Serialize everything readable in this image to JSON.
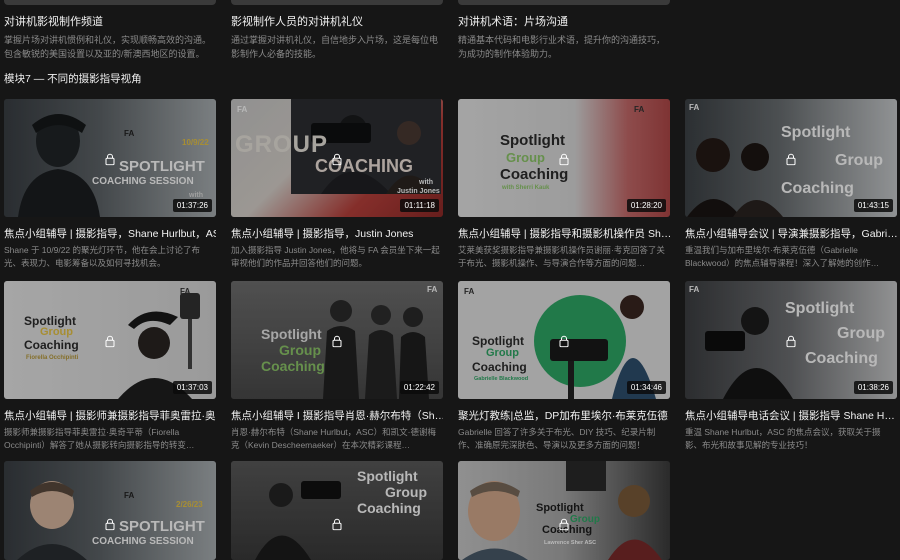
{
  "top_row": [
    {
      "title": "对讲机影视制作频道",
      "desc": "掌握片场对讲机惯例和礼仪，实现顺畅高效的沟通。包含敏锐的美国设置以及亚的/新澳西地区的设置。"
    },
    {
      "title": "影视制作人员的对讲机礼仪",
      "desc": "通过掌握对讲机礼仪，自信地步入片场，这是每位电影制作人必备的技能。"
    },
    {
      "title": "对讲机术语：片场沟通",
      "desc": "精通基本代码和电影行业术语，提升你的沟通技巧，为成功的制作体验助力。"
    }
  ],
  "module": {
    "title": "模块7 — 不同的摄影指导视角"
  },
  "cards": [
    {
      "title": "焦点小组辅导 | 摄影指导，Shane Hurlbut，ASC",
      "desc": "Shane 于 10/9/22 的聚光灯环节，他在会上讨论了布光、表现力、电影筹备以及如何寻找机会。",
      "duration": "01:37:26",
      "thumb": {
        "spotlight": "SPOTLIGHT",
        "coaching": "COACHING SESSION",
        "date": "10/9/22",
        "logo": "FA",
        "with": "with"
      }
    },
    {
      "title": "焦点小组辅导 | 摄影指导，Justin Jones",
      "desc": "加入摄影指导 Justin Jones，他将与 FA 会员坐下来一起审视他们的作品并回答他们的问题。",
      "duration": "01:11:18",
      "thumb": {
        "group": "GROUP",
        "coaching": "COACHING",
        "with": "with",
        "name": "Justin Jones",
        "logo": "FA"
      }
    },
    {
      "title": "焦点小组辅导 | 摄影指导和摄影机操作员 Sh…",
      "desc": "艾莱美获奖摄影指导兼摄影机操作员谢丽·考克回答了关于布光、摄影机操作、与导演合作等方面的问题…",
      "duration": "01:28:20",
      "thumb": {
        "spotlight": "Spotlight",
        "group": "Group",
        "coaching": "Coaching",
        "with": "with Sherri Kauk",
        "logo": "FA"
      }
    },
    {
      "title": "焦点小组辅导会议 | 导演兼摄影指导，Gabri…",
      "desc": "重温我们与加布里埃尔·布莱克伍德（Gabrielle Blackwood）的焦点辅导课程！深入了解她的创作…",
      "duration": "01:43:15",
      "thumb": {
        "spotlight": "Spotlight",
        "group": "Group",
        "coaching": "Coaching",
        "logo": "FA"
      }
    },
    {
      "title": "焦点小组辅导 | 摄影师兼摄影指导菲奥雷拉·奥…",
      "desc": "摄影师兼摄影指导菲奥雷拉·奥奇平蒂（Fiorella Occhipinti）解答了她从摄影转向摄影指导的转变…",
      "duration": "01:37:03",
      "thumb": {
        "spotlight": "Spotlight",
        "group": "Group",
        "coaching": "Coaching",
        "with": "Fiorella Occhipinti",
        "logo": "FA"
      }
    },
    {
      "title": "焦点小组辅导 I 摄影指导肖恩·赫尔布特（Sh…",
      "desc": "肖恩·赫尔布特（Shane Hurlbut，ASC）和凯文·德谢梅克（Kevin Descheemaeker）在本次精彩课程…",
      "duration": "01:22:42",
      "thumb": {
        "spotlight": "Spotlight",
        "group": "Group",
        "coaching": "Coaching",
        "logo": "FA"
      }
    },
    {
      "title": "聚光灯教练|总监，DP加布里埃尔·布莱克伍德",
      "desc": "Gabrielle 回答了许多关于布光、DIY 技巧、纪录片制作、准确原完深肤色、导演以及更多方面的问题！",
      "duration": "01:34:46",
      "thumb": {
        "spotlight": "Spotlight",
        "group": "Group",
        "coaching": "Coaching",
        "with": "Gabrielle Blackwood",
        "logo": "FA"
      }
    },
    {
      "title": "焦点小组辅导电话会议 | 摄影指导 Shane H…",
      "desc": "重温 Shane Hurlbut，ASC 的焦点会议，获取关于摄影、布光和故事见解的专业技巧！",
      "duration": "01:38:26",
      "thumb": {
        "spotlight": "Spotlight",
        "group": "Group",
        "coaching": "Coaching",
        "logo": "FA"
      }
    },
    {
      "title": "",
      "desc": "",
      "duration": "",
      "thumb": {
        "spotlight": "SPOTLIGHT",
        "coaching": "COACHING SESSION",
        "date": "2/26/23",
        "logo": "FA"
      }
    },
    {
      "title": "",
      "desc": "",
      "duration": "",
      "thumb": {
        "spotlight": "Spotlight",
        "group": "Group",
        "coaching": "Coaching"
      }
    },
    {
      "title": "",
      "desc": "",
      "duration": "",
      "thumb": {
        "spotlight": "Spotlight",
        "group": "Group",
        "coaching": "Coaching",
        "with": "Lawrence Sher ASC"
      }
    }
  ],
  "colors": {
    "background": "#161616",
    "title": "#f2f2f2",
    "desc": "#8a8a8a",
    "accent_yellow": "#e8c547",
    "accent_green": "#8ec86a"
  }
}
